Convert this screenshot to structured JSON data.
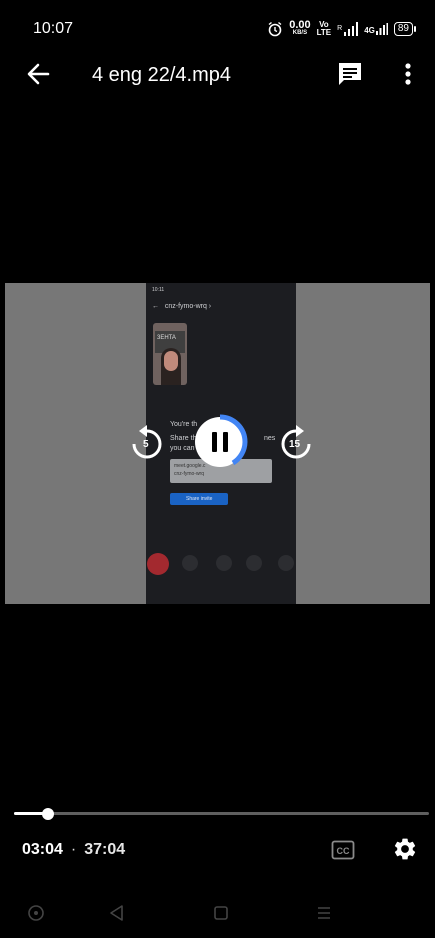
{
  "status_bar": {
    "time": "10:07",
    "speed_value": "0.00",
    "speed_unit": "KB/S",
    "volte_top": "Vo",
    "volte_bottom": "LTE",
    "signal_prefix": "R",
    "network": "4G",
    "battery": "89"
  },
  "app_bar": {
    "title": "4 eng 22/4.mp4",
    "back_icon": "arrow-left-icon",
    "subtitle_icon": "message-lines-icon",
    "more_icon": "dots-vertical-icon"
  },
  "video": {
    "meeting_title": "cnz-fymo-wrq",
    "heading": "You're th",
    "line1": "Share this",
    "line1_cont": "nes",
    "line2": "you can",
    "link_line1": "meet.google.c",
    "link_line2": "cnz-fymo-wrq",
    "share_label": "Share invite",
    "placard_text": "3EHTA"
  },
  "controls": {
    "rewind_seconds": "5",
    "forward_seconds": "15",
    "rewind_icon": "replay-5-icon",
    "forward_icon": "forward-15-icon",
    "pause_icon": "pause-icon",
    "current_time": "03:04",
    "separator": "·",
    "duration": "37:04",
    "progress_fraction": 0.083,
    "cc_icon": "closed-captions-icon",
    "settings_icon": "gear-icon"
  },
  "colors": {
    "accent": "#4285f4",
    "background": "#000000",
    "video_letterbox": "#777777"
  },
  "nav_bar": {
    "icons": [
      "home-circle-icon",
      "back-triangle-icon",
      "recents-square-icon",
      "menu-lines-icon"
    ]
  }
}
